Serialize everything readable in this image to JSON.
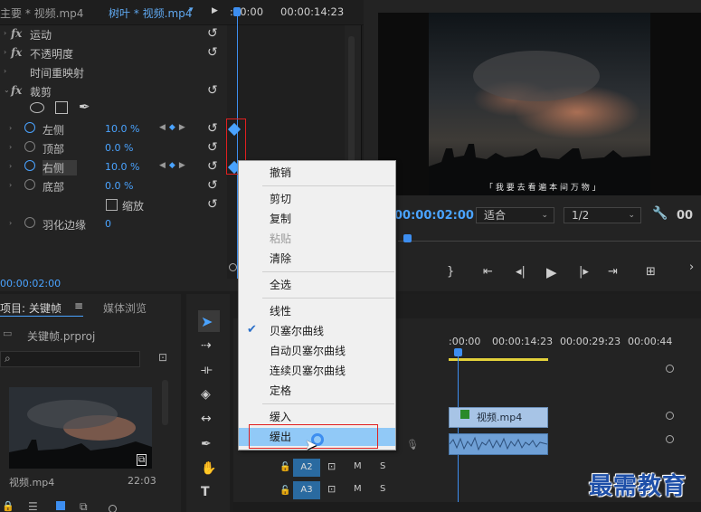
{
  "effect_controls": {
    "source_tab": "主要 * 视频.mp4",
    "clip_tab": "树叶 * 视频.mp4",
    "ruler_start": ":00:00",
    "ruler_end": "00:00:14:23",
    "current_time": "00:00:02:00",
    "properties": [
      {
        "fx": "fx",
        "label": "运动"
      },
      {
        "fx": "fx",
        "label": "不透明度"
      },
      {
        "fx": "",
        "label": "时间重映射"
      },
      {
        "fx": "fx",
        "label": "裁剪"
      }
    ],
    "crop_params": [
      {
        "label": "左侧",
        "value": "10.0 %"
      },
      {
        "label": "顶部",
        "value": "0.0 %"
      },
      {
        "label": "右侧",
        "value": "10.0 %"
      },
      {
        "label": "底部",
        "value": "0.0 %"
      },
      {
        "label": "缩放",
        "value": ""
      },
      {
        "label": "羽化边缘",
        "value": "0"
      }
    ]
  },
  "program_monitor": {
    "timecode": "00:00:02:00",
    "fit_option": "适合",
    "resolution": "1/2",
    "right_timecode": "00",
    "subtitle": "「 我 要 去 看 遍 本 间 万 物 」"
  },
  "project_panel": {
    "tab_label": "项目: 关键帧",
    "tab2_label": "媒体浏览",
    "project_file": "关键帧.prproj",
    "clip_name": "视频.mp4",
    "clip_duration": "22:03"
  },
  "timeline": {
    "ruler": [
      ":00:00",
      "00:00:14:23",
      "00:00:29:23",
      "00:00:44"
    ],
    "video_clip": "视频.mp4",
    "tracks": [
      "A2",
      "A3"
    ],
    "track_buttons": [
      "M",
      "S"
    ]
  },
  "context_menu": {
    "items": [
      {
        "label": "撤销",
        "enabled": true
      },
      {
        "label": "剪切",
        "enabled": true
      },
      {
        "label": "复制",
        "enabled": true
      },
      {
        "label": "粘贴",
        "enabled": false
      },
      {
        "label": "清除",
        "enabled": true
      },
      {
        "label": "全选",
        "enabled": true
      },
      {
        "label": "线性",
        "enabled": true
      },
      {
        "label": "贝塞尔曲线",
        "enabled": true,
        "checked": true
      },
      {
        "label": "自动贝塞尔曲线",
        "enabled": true
      },
      {
        "label": "连续贝塞尔曲线",
        "enabled": true
      },
      {
        "label": "定格",
        "enabled": true
      },
      {
        "label": "缓入",
        "enabled": true
      },
      {
        "label": "缓出",
        "enabled": true,
        "hovered": true
      }
    ]
  },
  "watermark": "最需教育",
  "colors": {
    "accent_blue": "#4aa3ff",
    "highlight_box": "#e02020",
    "menu_hover": "#91c9f7",
    "watermark": "#1e4fa8"
  }
}
